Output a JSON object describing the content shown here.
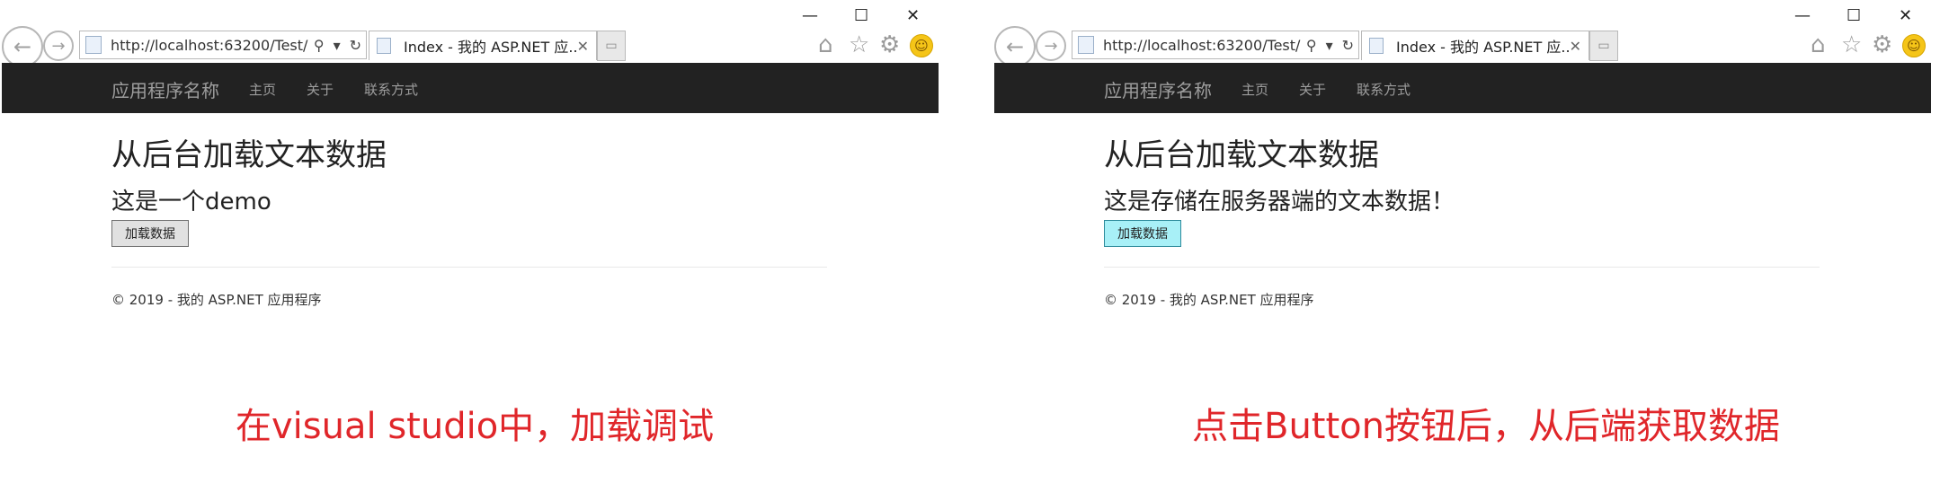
{
  "windows": [
    {
      "window_controls": {
        "minimize": "—",
        "maximize": "☐",
        "close": "✕"
      },
      "address_url": "http://localhost:63200/Test/",
      "tab_title": "Index - 我的 ASP.NET 应...",
      "navbar": {
        "brand": "应用程序名称",
        "links": [
          "主页",
          "关于",
          "联系方式"
        ]
      },
      "heading": "从后台加载文本数据",
      "text": "这是一个demo",
      "button_label": "加载数据",
      "button_state": "normal",
      "footer": "© 2019 - 我的 ASP.NET 应用程序"
    },
    {
      "window_controls": {
        "minimize": "—",
        "maximize": "☐",
        "close": "✕"
      },
      "address_url": "http://localhost:63200/Test/",
      "tab_title": "Index - 我的 ASP.NET 应...",
      "navbar": {
        "brand": "应用程序名称",
        "links": [
          "主页",
          "关于",
          "联系方式"
        ]
      },
      "heading": "从后台加载文本数据",
      "text": "这是存储在服务器端的文本数据！",
      "button_label": "加载数据",
      "button_state": "hover",
      "footer": "© 2019 - 我的 ASP.NET 应用程序"
    }
  ],
  "captions": [
    "在visual studio中，加载调试",
    "点击Button按钮后，从后端获取数据"
  ],
  "colors": {
    "navbar_bg": "#222222",
    "caption": "#e0262a",
    "button_hover_bg": "#a8f0f7"
  }
}
